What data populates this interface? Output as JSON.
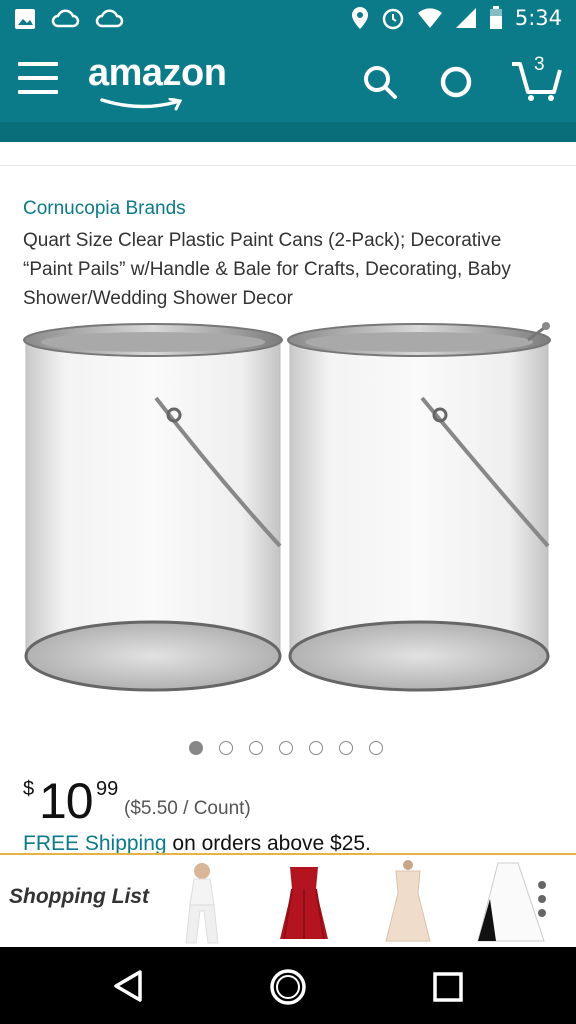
{
  "status_bar": {
    "time": "5:34",
    "icons": [
      "image-icon",
      "cloud-icon",
      "cloud-icon",
      "location-icon",
      "alarm-icon",
      "wifi-icon",
      "signal-icon",
      "battery-icon"
    ]
  },
  "header": {
    "logo": "amazon",
    "cart_count": "3",
    "icons": [
      "menu-icon",
      "search-icon",
      "alexa-icon",
      "cart-icon"
    ]
  },
  "product": {
    "brand": "Cornucopia Brands",
    "title": "Quart Size Clear Plastic Paint Cans (2-Pack); Decorative “Paint Pails” w/Handle & Bale for Crafts, Decorating, Baby Shower/Wedding Shower Decor",
    "image_count": 7,
    "active_image": 0,
    "price": {
      "currency": "$",
      "whole": "10",
      "fraction": "99",
      "unit_price": "($5.50 / Count)"
    },
    "shipping": {
      "link": "FREE Shipping",
      "text": " on orders above $25."
    }
  },
  "shopping_list": {
    "label": "Shopping List",
    "items": [
      "lingerie-thumbnail",
      "red-dress-thumbnail",
      "cream-dress-thumbnail",
      "black-skirt-thumbnail"
    ]
  },
  "nav_bar": {
    "buttons": [
      "back-button",
      "home-button",
      "recents-button"
    ]
  },
  "colors": {
    "teal": "#0b7a89",
    "accent_yellow": "#e5b33e"
  }
}
